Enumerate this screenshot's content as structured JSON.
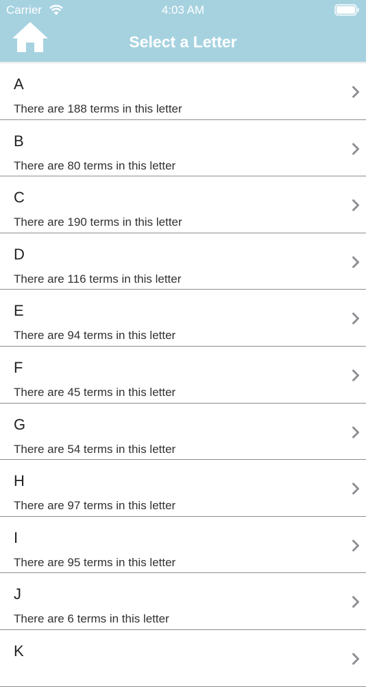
{
  "status_bar": {
    "carrier": "Carrier",
    "time": "4:03 AM"
  },
  "nav": {
    "title": "Select a Letter",
    "home_icon": "home-icon"
  },
  "colors": {
    "header_bg": "#a6d2e0",
    "chevron": "#8e8e93",
    "separator": "#8c8c8c"
  },
  "letters": [
    {
      "letter": "A",
      "subtitle": "There are 188 terms in this letter"
    },
    {
      "letter": "B",
      "subtitle": "There are 80 terms in this letter"
    },
    {
      "letter": "C",
      "subtitle": "There are 190 terms in this letter"
    },
    {
      "letter": "D",
      "subtitle": "There are 116 terms in this letter"
    },
    {
      "letter": "E",
      "subtitle": "There are 94 terms in this letter"
    },
    {
      "letter": "F",
      "subtitle": "There are 45 terms in this letter"
    },
    {
      "letter": "G",
      "subtitle": "There are 54 terms in this letter"
    },
    {
      "letter": "H",
      "subtitle": "There are 97 terms in this letter"
    },
    {
      "letter": "I",
      "subtitle": "There are 95 terms in this letter"
    },
    {
      "letter": "J",
      "subtitle": "There are 6 terms in this letter"
    },
    {
      "letter": "K",
      "subtitle": ""
    }
  ]
}
